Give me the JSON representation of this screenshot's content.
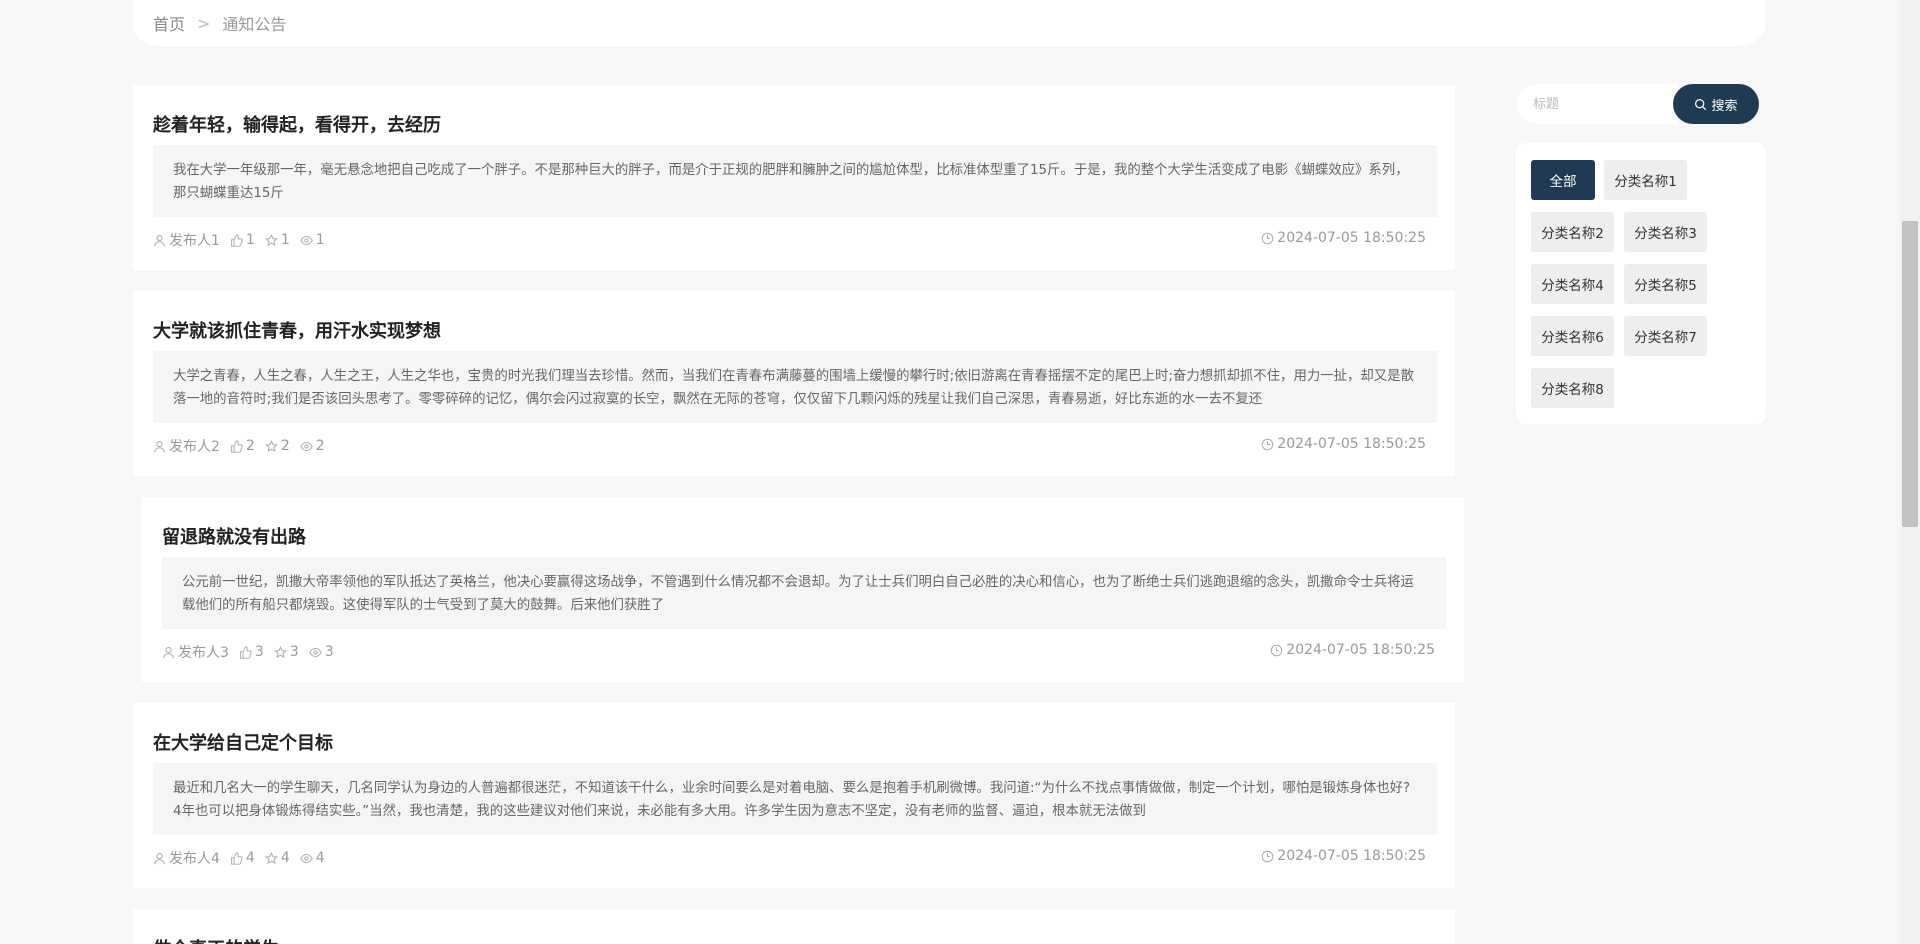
{
  "breadcrumb": {
    "home": "首页",
    "separator": ">",
    "current": "通知公告"
  },
  "search": {
    "placeholder": "标题",
    "button_label": "搜索"
  },
  "categories": [
    "全部",
    "分类名称1",
    "分类名称2",
    "分类名称3",
    "分类名称4",
    "分类名称5",
    "分类名称6",
    "分类名称7",
    "分类名称8"
  ],
  "articles": [
    {
      "title": "趁着年轻，输得起，看得开，去经历",
      "summary": "我在大学一年级那一年，毫无悬念地把自己吃成了一个胖子。不是那种巨大的胖子，而是介于正规的肥胖和臃肿之间的尴尬体型，比标准体型重了15斤。于是，我的整个大学生活变成了电影《蝴蝶效应》系列，那只蝴蝶重达15斤",
      "author": "发布人1",
      "likes": "1",
      "favorites": "1",
      "views": "1",
      "date": "2024-07-05 18:50:25"
    },
    {
      "title": "大学就该抓住青春，用汗水实现梦想",
      "summary": "大学之青春，人生之春，人生之王，人生之华也，宝贵的时光我们理当去珍惜。然而，当我们在青春布满藤蔓的围墙上缓慢的攀行时;依旧游离在青春摇摆不定的尾巴上时;奋力想抓却抓不住，用力一扯，却又是散落一地的音符时;我们是否该回头思考了。零零碎碎的记忆，偶尔会闪过寂寞的长空，飘然在无际的苍穹，仅仅留下几颗闪烁的残星让我们自己深思，青春易逝，好比东逝的水一去不复还",
      "author": "发布人2",
      "likes": "2",
      "favorites": "2",
      "views": "2",
      "date": "2024-07-05 18:50:25"
    },
    {
      "title": "留退路就没有出路",
      "summary": "公元前一世纪，凯撒大帝率领他的军队抵达了英格兰，他决心要赢得这场战争，不管遇到什么情况都不会退却。为了让士兵们明白自己必胜的决心和信心，也为了断绝士兵们逃跑退缩的念头，凯撒命令士兵将运载他们的所有船只都烧毁。这使得军队的士气受到了莫大的鼓舞。后来他们获胜了",
      "author": "发布人3",
      "likes": "3",
      "favorites": "3",
      "views": "3",
      "date": "2024-07-05 18:50:25"
    },
    {
      "title": "在大学给自己定个目标",
      "summary": "最近和几名大一的学生聊天，几名同学认为身边的人普遍都很迷茫，不知道该干什么，业余时间要么是对着电脑、要么是抱着手机刷微博。我问道:“为什么不找点事情做做，制定一个计划，哪怕是锻炼身体也好?4年也可以把身体锻炼得结实些。”当然，我也清楚，我的这些建议对他们来说，未必能有多大用。许多学生因为意志不坚定，没有老师的监督、逼迫，根本就无法做到",
      "author": "发布人4",
      "likes": "4",
      "favorites": "4",
      "views": "4",
      "date": "2024-07-05 18:50:25"
    },
    {
      "title": "做个真正的学生"
    }
  ]
}
